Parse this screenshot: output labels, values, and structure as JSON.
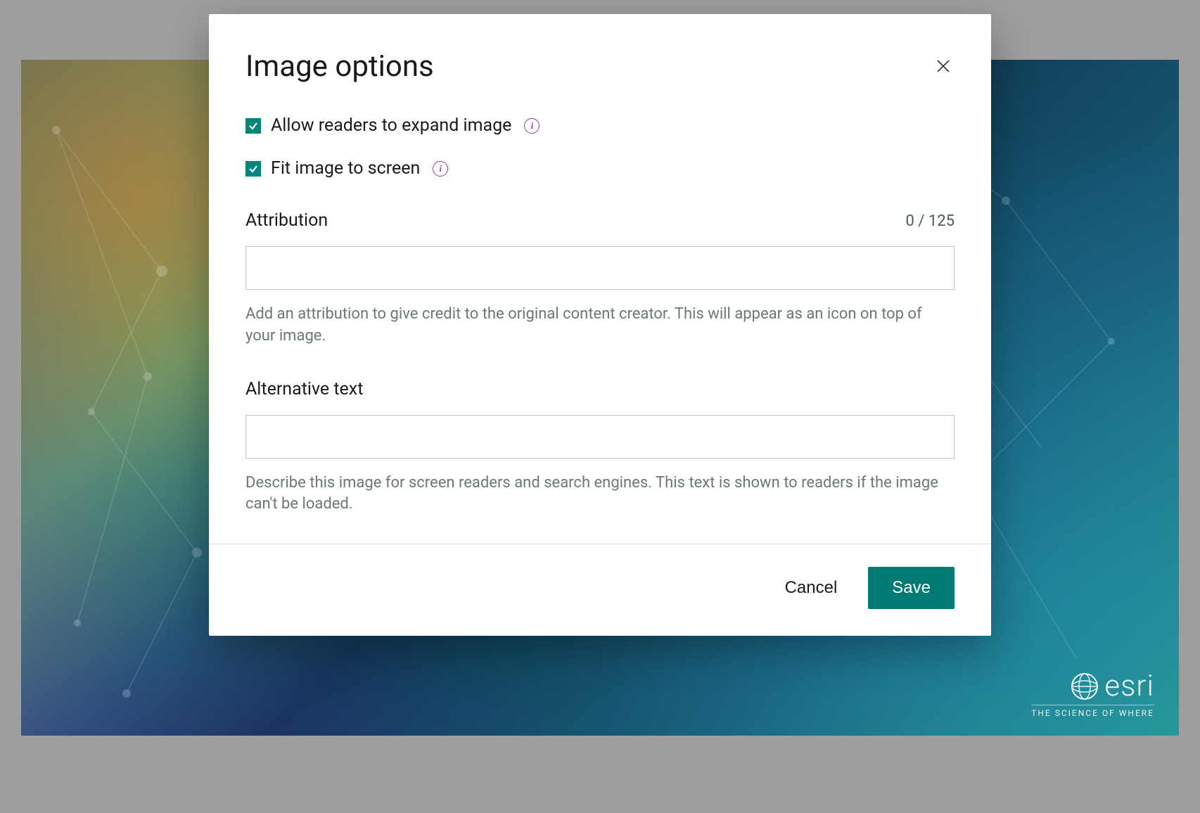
{
  "modal": {
    "title": "Image options",
    "checkboxes": {
      "allow_expand": {
        "label": "Allow readers to expand image",
        "checked": true
      },
      "fit_screen": {
        "label": "Fit image to screen",
        "checked": true
      }
    },
    "attribution": {
      "label": "Attribution",
      "counter": "0 / 125",
      "value": "",
      "help": "Add an attribution to give credit to the original content creator. This will appear as an icon on top of your image."
    },
    "alt_text": {
      "label": "Alternative text",
      "value": "",
      "help": "Describe this image for screen readers and search engines. This text is shown to readers if the image can't be loaded."
    },
    "footer": {
      "cancel": "Cancel",
      "save": "Save"
    }
  },
  "background": {
    "brand": "esri",
    "tagline": "THE SCIENCE OF WHERE"
  }
}
